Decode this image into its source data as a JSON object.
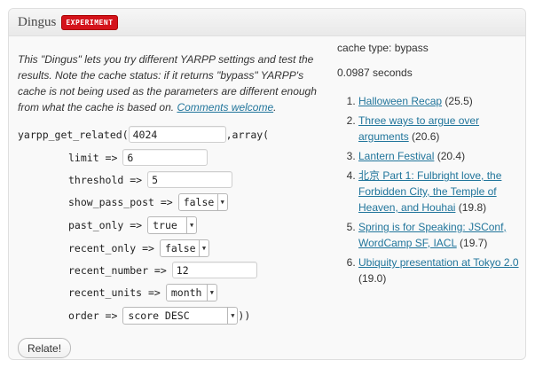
{
  "panel": {
    "title": "Dingus",
    "badge": "EXPERIMENT"
  },
  "intro": {
    "text": "This \"Dingus\" lets you try different YARPP settings and test the results. Note the cache status: if it returns \"bypass\" YARPP's cache is not being used as the parameters are different enough from what the cache is based on. ",
    "link": "Comments welcome",
    "tail": "."
  },
  "call": {
    "fn_open": "yarpp_get_related(",
    "post_id": "4024",
    "array_open": ",array(",
    "close": "))"
  },
  "params": {
    "limit": {
      "label": "limit =>",
      "value": "6"
    },
    "threshold": {
      "label": "threshold =>",
      "value": "5"
    },
    "show_pass_post": {
      "label": "show_pass_post =>",
      "value": "false"
    },
    "past_only": {
      "label": "past_only =>",
      "value": "true"
    },
    "recent_only": {
      "label": "recent_only =>",
      "value": "false"
    },
    "recent_number": {
      "label": "recent_number =>",
      "value": "12"
    },
    "recent_units": {
      "label": "recent_units =>",
      "value": "month"
    },
    "order": {
      "label": "order =>",
      "value": "score DESC"
    }
  },
  "relate_button": "Relate!",
  "status": {
    "cache": "cache type: bypass",
    "time": "0.0987 seconds"
  },
  "results": [
    {
      "title": "Halloween Recap",
      "score": "(25.5)"
    },
    {
      "title": "Three ways to argue over arguments",
      "score": "(20.6)"
    },
    {
      "title": "Lantern Festival",
      "score": "(20.4)"
    },
    {
      "title": "北京 Part 1: Fulbright love, the Forbidden City, the Temple of Heaven, and Houhai",
      "score": "(19.8)"
    },
    {
      "title": "Spring is for Speaking: JSConf, WordCamp SF, IACL",
      "score": "(19.7)"
    },
    {
      "title": "Ubiquity presentation at Tokyo 2.0",
      "score": "(19.0)"
    }
  ]
}
